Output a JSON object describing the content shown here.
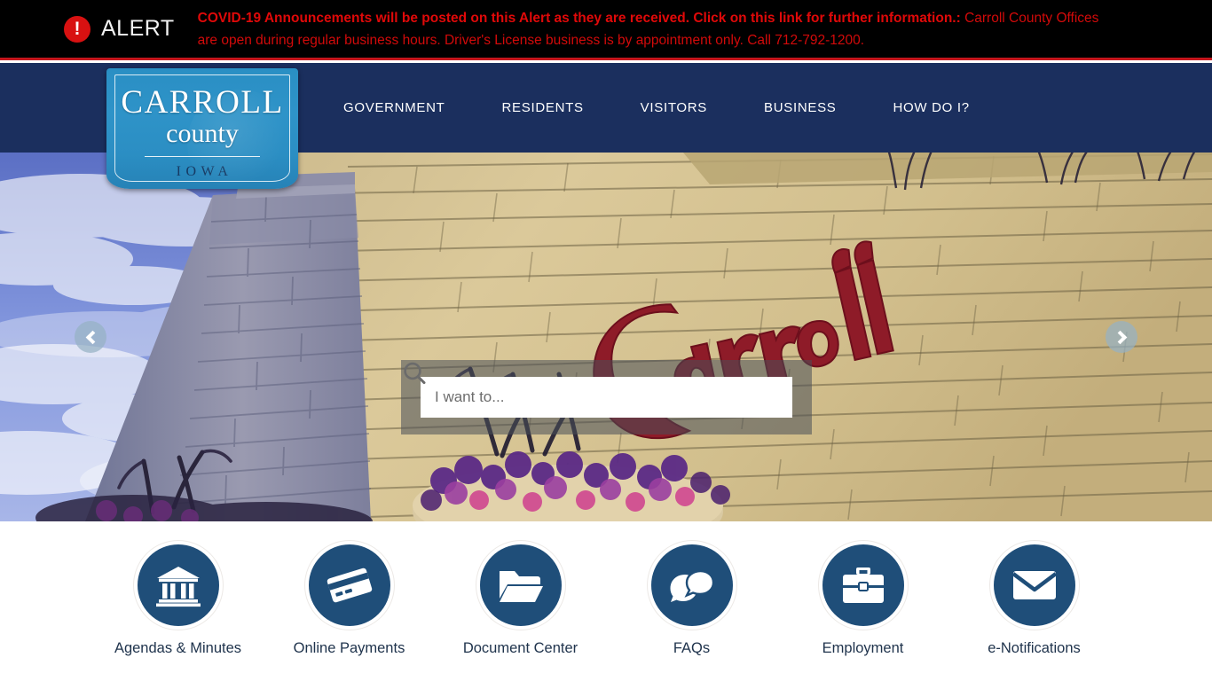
{
  "alert": {
    "icon": "exclamation-circle-icon",
    "word": "ALERT",
    "headline": "COVID-19 Announcements will be posted on this Alert as they are received. Click on this link for further information.:",
    "body": " Carroll County Offices are open during regular business hours. Driver's License business is by appointment only. Call 712-792-1200.",
    "bar_color": "#000000",
    "text_color": "#d20a0a",
    "rule_color": "#c4161c"
  },
  "logo": {
    "line1": "CARROLL",
    "line2": "county",
    "line3": "IOWA",
    "bg_color": "#2b8ec3"
  },
  "nav": {
    "bg_color": "#1b2f5e",
    "items": [
      {
        "label": "GOVERNMENT"
      },
      {
        "label": "RESIDENTS"
      },
      {
        "label": "VISITORS"
      },
      {
        "label": "BUSINESS"
      },
      {
        "label": "HOW DO I?"
      }
    ]
  },
  "hero": {
    "search": {
      "placeholder": "I want to...",
      "value": "",
      "icon": "search-icon"
    },
    "prev_icon": "chevron-left-icon",
    "next_icon": "chevron-right-icon",
    "scene_text": "Carroll"
  },
  "quick_links": [
    {
      "label": "Agendas & Minutes",
      "icon": "bank-building-icon"
    },
    {
      "label": "Online Payments",
      "icon": "credit-card-icon"
    },
    {
      "label": "Document Center",
      "icon": "folder-icon"
    },
    {
      "label": "FAQs",
      "icon": "speech-bubbles-icon"
    },
    {
      "label": "Employment",
      "icon": "briefcase-icon"
    },
    {
      "label": "e-Notifications",
      "icon": "envelope-icon"
    }
  ],
  "colors": {
    "circle": "#1f4e79",
    "label": "#20344d"
  }
}
